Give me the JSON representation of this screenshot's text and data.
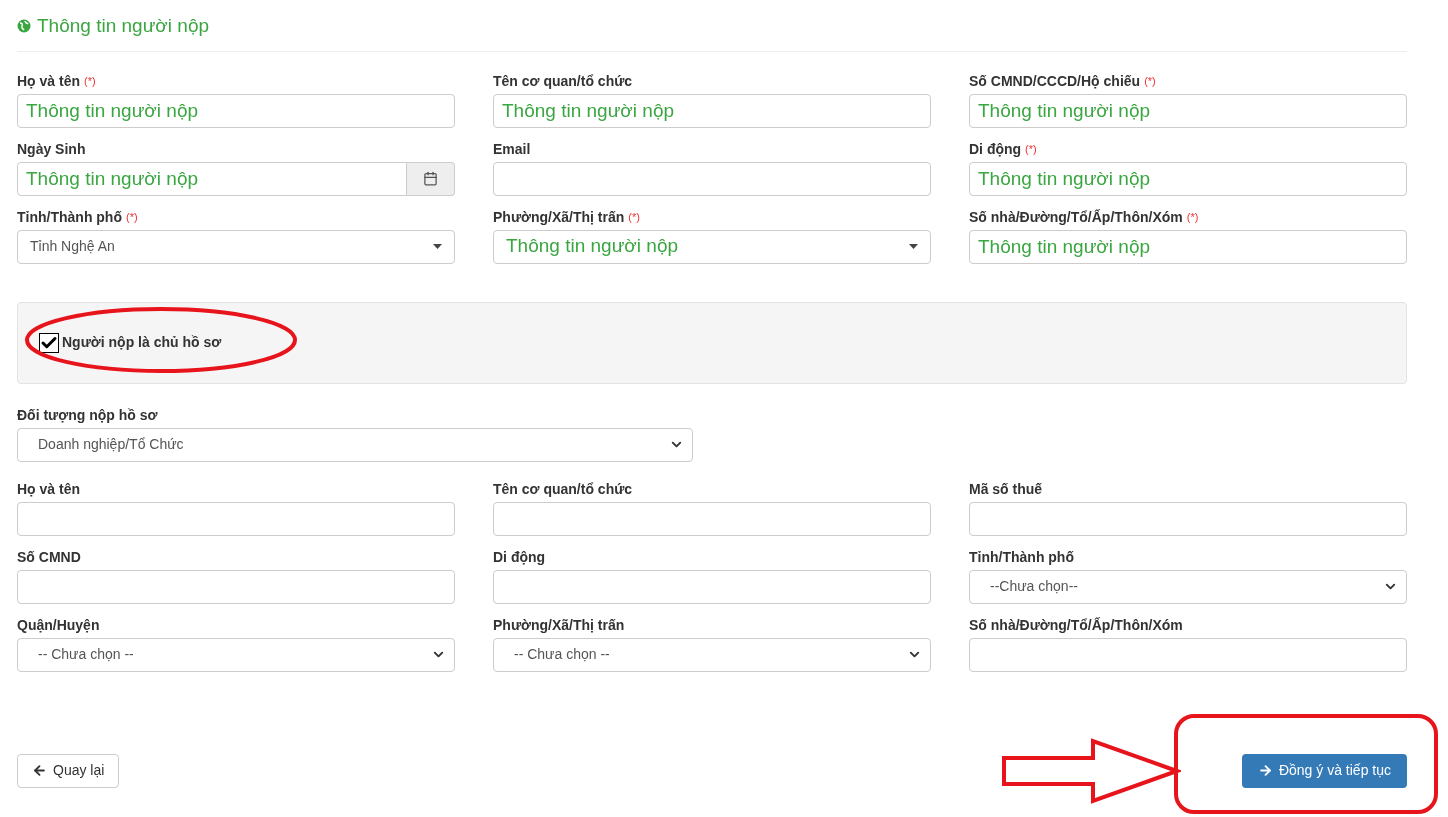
{
  "section_title": "Thông tin người nộp",
  "applicant_fields": [
    {
      "label": "Họ và tên",
      "required_mark": "(*)",
      "kind": "text",
      "value": "Thông tin người nộp",
      "highlighted": true
    },
    {
      "label": "Tên cơ quan/tổ chức",
      "kind": "text",
      "value": "Thông tin người nộp",
      "highlighted": true
    },
    {
      "label": "Số CMND/CCCD/Hộ chiếu",
      "required_mark": "(*)",
      "kind": "text",
      "value": "Thông tin người nộp",
      "highlighted": true
    },
    {
      "label": "Ngày Sinh",
      "kind": "date",
      "value": "Thông tin người nộp",
      "highlighted": true
    },
    {
      "label": "Email",
      "kind": "text"
    },
    {
      "label": "Di động",
      "required_mark": "(*)",
      "kind": "text",
      "value": "Thông tin người nộp",
      "highlighted": true
    },
    {
      "label": "Tỉnh/Thành phố",
      "required_mark": "(*)",
      "kind": "dropdown",
      "value": "Tỉnh Nghệ An",
      "highlighted": false
    },
    {
      "label": "Phường/Xã/Thị trấn",
      "required_mark": "(*)",
      "kind": "dropdown",
      "value": "Thông tin người nộp",
      "highlighted": true
    },
    {
      "label": "Số nhà/Đường/Tổ/Ấp/Thôn/Xóm",
      "required_mark": "(*)",
      "kind": "text",
      "value": "Thông tin người nộp",
      "highlighted": true
    }
  ],
  "owner_checkbox": {
    "label": "Người nộp là chủ hồ sơ",
    "checked": true
  },
  "applicant_type": {
    "label": "Đối tượng nộp hồ sơ",
    "value": "Doanh nghiệp/Tổ Chức"
  },
  "owner_fields": [
    {
      "label": "Họ và tên",
      "kind": "text"
    },
    {
      "label": "Tên cơ quan/tổ chức",
      "kind": "text"
    },
    {
      "label": "Mã số thuế",
      "kind": "text"
    },
    {
      "label": "Số CMND",
      "kind": "text"
    },
    {
      "label": "Di động",
      "kind": "text"
    },
    {
      "label": "Tỉnh/Thành phố",
      "kind": "select",
      "value": "--Chưa chọn--"
    },
    {
      "label": "Quận/Huyện",
      "kind": "select",
      "value": "-- Chưa chọn --"
    },
    {
      "label": "Phường/Xã/Thị trấn",
      "kind": "select",
      "value": "-- Chưa chọn --"
    },
    {
      "label": "Số nhà/Đường/Tổ/Ấp/Thôn/Xóm",
      "kind": "text"
    }
  ],
  "buttons": [
    {
      "label": "Quay lại",
      "kind": "back"
    },
    {
      "label": "Đồng ý và tiếp tục",
      "kind": "primary"
    }
  ]
}
